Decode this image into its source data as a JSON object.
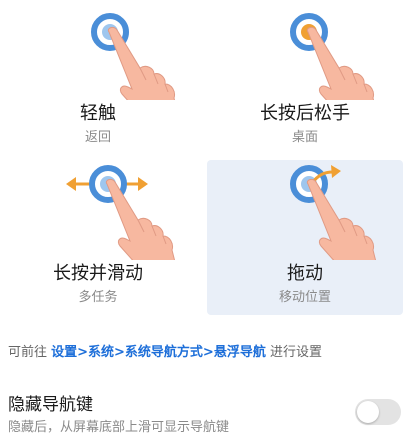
{
  "gestures": [
    {
      "title": "轻触",
      "subtitle": "返回"
    },
    {
      "title": "长按后松手",
      "subtitle": "桌面"
    },
    {
      "title": "长按并滑动",
      "subtitle": "多任务"
    },
    {
      "title": "拖动",
      "subtitle": "移动位置"
    }
  ],
  "selected_gesture": "拖动",
  "hint": {
    "prefix": "可前往 ",
    "path": "设置>系统>系统导航方式>悬浮导航",
    "suffix": " 进行设置"
  },
  "setting": {
    "title": "隐藏导航键",
    "description": "隐藏后，从屏幕底部上滑可显示导航键",
    "toggle_on": false
  },
  "colors": {
    "accent_blue": "#4a8ed8",
    "press_orange": "#f0a033",
    "hand_skin": "#f7b8a0",
    "selected_bg": "#e9eff8",
    "link": "#1e6fd9"
  }
}
